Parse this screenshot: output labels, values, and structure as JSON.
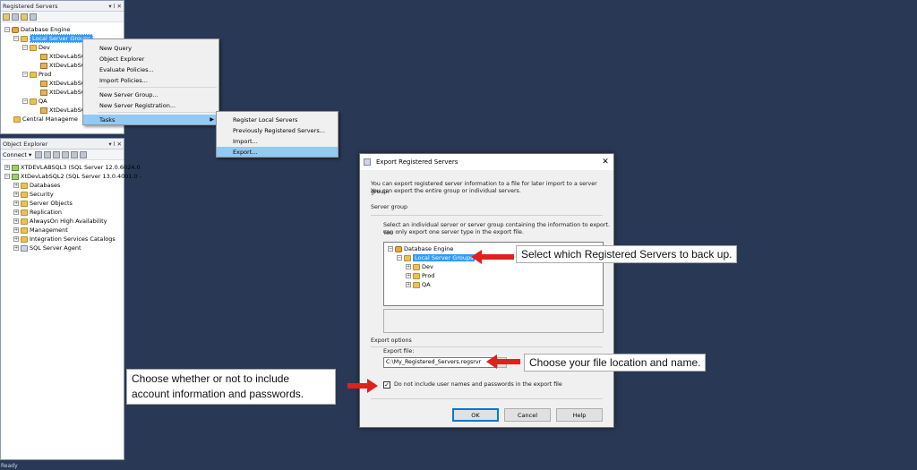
{
  "registered_servers": {
    "title": "Registered Servers",
    "pin": "▾ ⅼ ✕",
    "tree": {
      "database_engine": "Database Engine",
      "local_server_groups": "Local Server Groups",
      "dev": "Dev",
      "dev_server_1": "XtDevLabSC",
      "dev_server_2": "XtDevLabSC",
      "prod": "Prod",
      "prod_server_1": "XtDevLabSC",
      "prod_server_2": "XtDevLabSC",
      "qa": "QA",
      "qa_server_1": "XtDevLabSC",
      "central_management": "Central Manageme"
    }
  },
  "context_menu": {
    "items": [
      "New Query",
      "Object Explorer",
      "Evaluate Policies...",
      "Import Policies...",
      "New Server Group...",
      "New Server Registration...",
      "Tasks"
    ]
  },
  "tasks_submenu": {
    "items": [
      "Register Local Servers",
      "Previously Registered Servers...",
      "Import...",
      "Export..."
    ]
  },
  "object_explorer": {
    "title": "Object Explorer",
    "pin": "▾ ⅼ ✕",
    "connect_label": "Connect ▾",
    "servers": [
      "XTDEVLABSQL3 (SQL Server 12.0.6024.0",
      "XtDevLabSQL2 (SQL Server 13.0.4001.0 -"
    ],
    "children": [
      "Databases",
      "Security",
      "Server Objects",
      "Replication",
      "AlwaysOn High Availability",
      "Management",
      "Integration Services Catalogs",
      "SQL Server Agent"
    ]
  },
  "dialog": {
    "title": "Export Registered Servers",
    "close": "✕",
    "intro_line1": "You can export registered server information to a file for later import to a server group.",
    "intro_line2": "You can export the entire group or individual servers.",
    "server_group_label": "Server group",
    "select_line1": "Select an individual server or server group containing the information to export. You",
    "select_line2": "can only export one server type in the export file.",
    "tree": {
      "database_engine": "Database Engine",
      "local_server_groups": "Local Server Groups",
      "dev": "Dev",
      "prod": "Prod",
      "qa": "QA"
    },
    "export_options_label": "Export options",
    "export_file_label": "Export file:",
    "export_file_value": "C:\\My_Registered_Servers.regsrvr",
    "browse": "...",
    "checkbox_label": "Do not include user names and passwords in the export file",
    "checkbox_mark": "✓",
    "ok": "OK",
    "cancel": "Cancel",
    "help": "Help"
  },
  "callouts": {
    "select": "Select which Registered Servers to back up.",
    "file": "Choose your file location and name.",
    "account_line1": "Choose whether or not to include",
    "account_line2": "account information and passwords."
  },
  "status": "Ready",
  "colors": {
    "background": "#293955",
    "selection": "#3399ff",
    "arrow": "#e0201b",
    "menu_highlight": "#91c9f7"
  }
}
